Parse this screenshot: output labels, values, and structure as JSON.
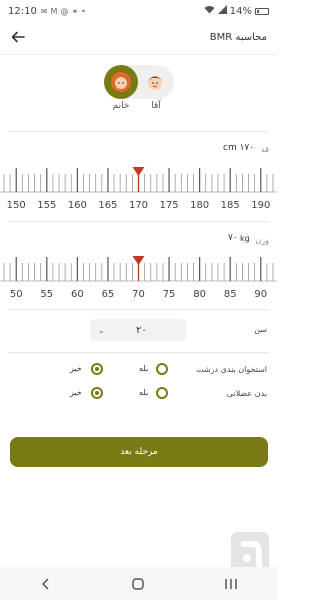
{
  "status_bar": {
    "time": "12:10",
    "notification_icons": [
      "message-icon",
      "mail-icon",
      "at-icon",
      "link-icon",
      "dot-icon"
    ],
    "battery": "14%"
  },
  "header": {
    "title": "محاسبه BMR",
    "back_icon": "arrow-left-icon"
  },
  "gender": {
    "female_label": "خانم",
    "male_label": "آقا",
    "selected": "female"
  },
  "height": {
    "label": "قد",
    "value": "۱۷۰ cm",
    "ticks": [
      "150",
      "155",
      "160",
      "165",
      "170",
      "175",
      "180",
      "185",
      "190"
    ],
    "current": 170,
    "min": 148,
    "max": 192
  },
  "weight": {
    "label": "وزن",
    "value": "۷۰",
    "unit": "kg",
    "ticks": [
      "50",
      "55",
      "60",
      "65",
      "70",
      "75",
      "80",
      "85",
      "90"
    ],
    "current": 70,
    "min": 48,
    "max": 92
  },
  "age": {
    "label": "سن",
    "value": "۲۰"
  },
  "questions": {
    "yes_label": "بله",
    "no_label": "خیر",
    "big_bones": {
      "label": "استخوان بندی درشت",
      "selected": "no"
    },
    "muscular": {
      "label": "بدن عضلانی",
      "selected": "no"
    }
  },
  "actions": {
    "next_label": "مرحله بعد"
  },
  "colors": {
    "accent": "#7a7a14",
    "indicator": "#c0392b"
  }
}
